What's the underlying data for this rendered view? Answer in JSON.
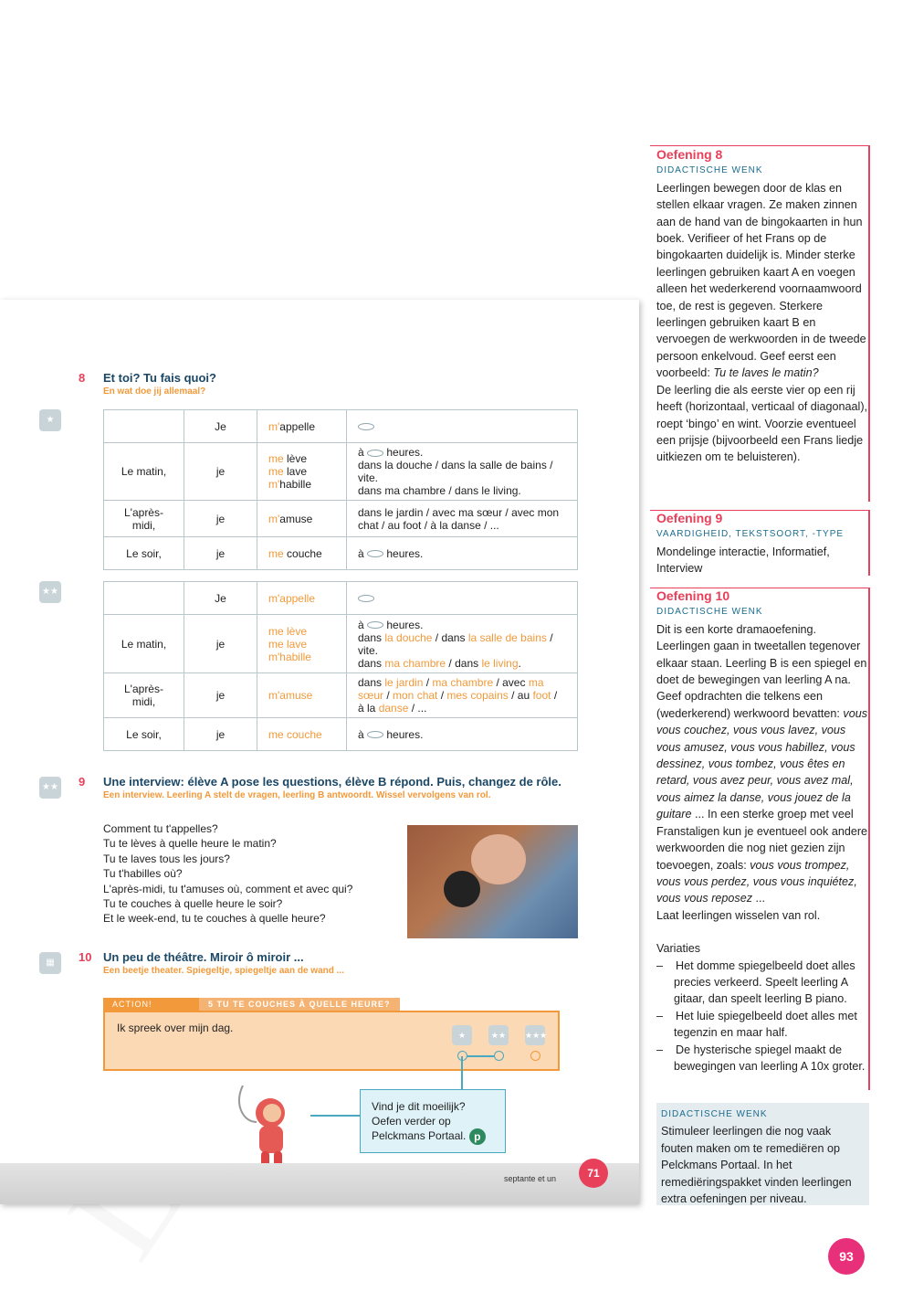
{
  "watermark": "Leesexemplaar",
  "book": {
    "ex8": {
      "num": "8",
      "title": "Et toi? Tu fais quoi?",
      "subtitle": "En wat doe jij allemaal?",
      "table1": [
        [
          "",
          "Je",
          [
            "m'",
            "appelle"
          ],
          "lips"
        ],
        [
          "Le matin,",
          "je",
          [
            [
              "me ",
              "lève"
            ],
            [
              "me ",
              "lave"
            ],
            [
              "m'",
              "habille"
            ]
          ],
          [
            "à ",
            "lips",
            " heures.",
            "dans la douche / dans la salle de bains / vite.",
            "dans ma chambre / dans le living."
          ]
        ],
        [
          "L'après-midi,",
          "je",
          [
            "m'",
            "amuse"
          ],
          "dans le jardin / avec ma sœur / avec mon chat / au foot / à la danse / ..."
        ],
        [
          "Le soir,",
          "je",
          [
            "me ",
            "couche"
          ],
          [
            "à ",
            "lips",
            " heures."
          ]
        ]
      ],
      "table2_lines": {
        "r1": "Je",
        "r1v": "m'appelle",
        "r2": "Le matin,",
        "r2v1": "me lève",
        "r2v2": "me lave",
        "r2v3": "m'habille",
        "r3": "L'après-midi,",
        "r3v": "m'amuse",
        "r4": "Le soir,",
        "r4v": "me couche",
        "je": "je",
        "a": "à",
        "heures": "heures.",
        "d1": "dans",
        "d1a": "la douche",
        "d1b": "dans",
        "d1c": "la salle de bains",
        "d1d": "/ vite.",
        "d2": "dans",
        "d2a": "ma chambre",
        "d2b": "/ dans",
        "d2c": "le living",
        "j1": "dans",
        "j1a": "le jardin",
        "j1b": "ma chambre",
        "j1c": "/ avec",
        "j1d": "ma sœur",
        "j1e": "mon chat",
        "j1f": "mes copains",
        "j1g": "/ au",
        "j1h": "foot",
        "j1i": "à la",
        "j1j": "danse",
        "j1k": "/ ..."
      }
    },
    "ex9": {
      "num": "9",
      "title": "Une interview: élève A pose les questions, élève B répond. Puis, changez de rôle.",
      "subtitle": "Een interview. Leerling A stelt de vragen, leerling B antwoordt. Wissel vervolgens van rol.",
      "questions": [
        "Comment tu t'appelles?",
        "Tu te lèves à quelle heure le matin?",
        "Tu te laves tous les jours?",
        "Tu t'habilles où?",
        "L'après-midi, tu t'amuses où, comment et avec qui?",
        "Tu te couches à quelle heure le soir?",
        "Et le week-end, tu te couches à quelle heure?"
      ]
    },
    "ex10": {
      "num": "10",
      "title": "Un peu de théâtre. Miroir ô miroir ...",
      "subtitle": "Een beetje theater. Spiegeltje, spiegeltje aan de wand ..."
    },
    "action": {
      "tab": "ACTION!",
      "lesson": "5  TU TE COUCHES À QUELLE HEURE?",
      "text": "Ik spreek over mijn dag."
    },
    "callout": {
      "l1": "Vind je dit moeilijk?",
      "l2": "Oefen verder op",
      "l3": "Pelckmans Portaal.",
      "logo": "p"
    },
    "page_text": "septante et un",
    "page_num": "71"
  },
  "side": {
    "o8": {
      "title": "Oefening 8",
      "label": "DIDACTISCHE WENK",
      "text": "Leerlingen bewegen door de klas en stellen elkaar vragen. Ze maken zinnen aan de hand van de bingokaarten in hun boek. Verifieer of het Frans op de bingokaarten duidelijk is. Minder sterke leerlingen gebruiken kaart A en voegen alleen het wederkerend voornaamwoord toe, de rest is gegeven. Sterkere leerlingen gebruiken kaart B en vervoegen de werkwoorden in de tweede persoon enkelvoud. Geef eerst een voorbeeld: ",
      "italic": "Tu te laves le matin?",
      "text2": "De leerling die als eerste vier op een rij heeft (horizontaal, verticaal of diagonaal), roept ‘bingo’ en wint. Voorzie eventueel een prijsje (bijvoorbeeld een Frans liedje uitkiezen om te beluisteren)."
    },
    "o9": {
      "title": "Oefening 9",
      "label": "VAARDIGHEID, TEKSTSOORT, -TYPE",
      "text": "Mondelinge interactie, Informatief, Interview"
    },
    "o10": {
      "title": "Oefening 10",
      "label": "DIDACTISCHE WENK",
      "text": "Dit is een korte dramaoefening. Leerlingen gaan in tweetallen tegenover elkaar staan. Leerling B is een spiegel en doet de bewegingen van leerling A na. Geef opdrachten die telkens een (wederkerend) werkwoord bevatten: ",
      "italic": "vous vous couchez, vous vous lavez, vous vous amusez, vous vous habillez, vous dessinez, vous tombez, vous êtes en retard, vous avez peur, vous avez mal, vous aimez la danse, vous jouez de la guitare",
      "text2": " ... In een sterke groep met veel Franstaligen kun je eventueel ook andere werkwoorden die nog niet gezien zijn toevoegen, zoals: ",
      "italic2": "vous vous trompez, vous vous perdez, vous vous inquiétez, vous vous reposez",
      "text3": " ...",
      "text4": "Laat leerlingen wisselen van rol.",
      "variaties": "Variaties",
      "items": [
        "Het domme spiegelbeeld doet alles precies verkeerd. Speelt leerling A gitaar, dan speelt leerling B piano.",
        "Het luie spiegelbeeld doet alles met tegenzin en maar half.",
        "De hysterische spiegel maakt de bewegingen van leerling A 10x groter."
      ]
    },
    "tip": {
      "label": "DIDACTISCHE WENK",
      "text": "Stimuleer leerlingen die nog vaak fouten maken om te remediëren op Pelckmans Portaal. In het remediëringspakket vinden leerlingen extra oefeningen per niveau."
    }
  },
  "page_num": "93",
  "colors": {
    "accent_red": "#e8405a",
    "orange": "#f29a3b",
    "navy": "#1b4766",
    "teal": "#4aa8c0"
  }
}
